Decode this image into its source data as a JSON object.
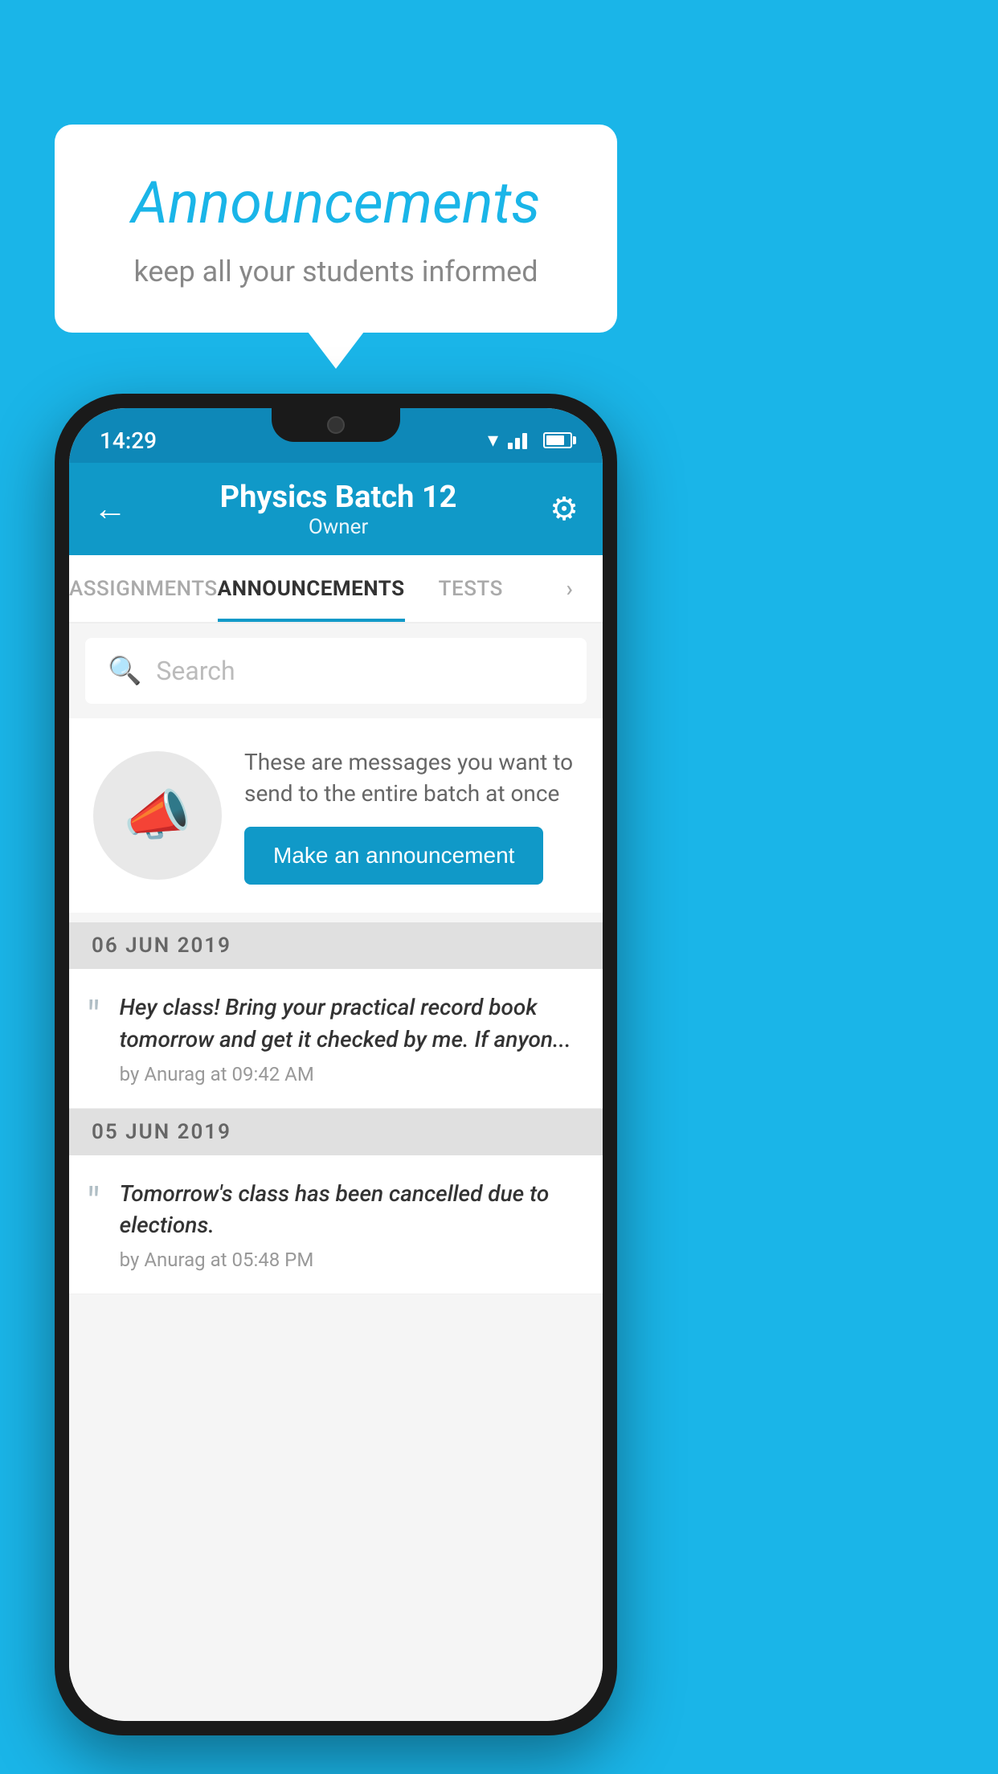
{
  "background_color": "#1ab5e8",
  "speech_bubble": {
    "title": "Announcements",
    "subtitle": "keep all your students informed"
  },
  "phone": {
    "status_bar": {
      "time": "14:29"
    },
    "header": {
      "title": "Physics Batch 12",
      "subtitle": "Owner",
      "back_label": "←",
      "settings_label": "⚙"
    },
    "tabs": [
      {
        "label": "ASSIGNMENTS",
        "active": false
      },
      {
        "label": "ANNOUNCEMENTS",
        "active": true
      },
      {
        "label": "TESTS",
        "active": false
      },
      {
        "label": "»",
        "active": false
      }
    ],
    "search": {
      "placeholder": "Search"
    },
    "promo": {
      "description": "These are messages you want to send to the entire batch at once",
      "button_label": "Make an announcement"
    },
    "announcements": [
      {
        "date": "06  JUN  2019",
        "items": [
          {
            "text": "Hey class! Bring your practical record book tomorrow and get it checked by me. If anyon...",
            "meta": "by Anurag at 09:42 AM"
          }
        ]
      },
      {
        "date": "05  JUN  2019",
        "items": [
          {
            "text": "Tomorrow's class has been cancelled due to elections.",
            "meta": "by Anurag at 05:48 PM"
          }
        ]
      }
    ]
  }
}
